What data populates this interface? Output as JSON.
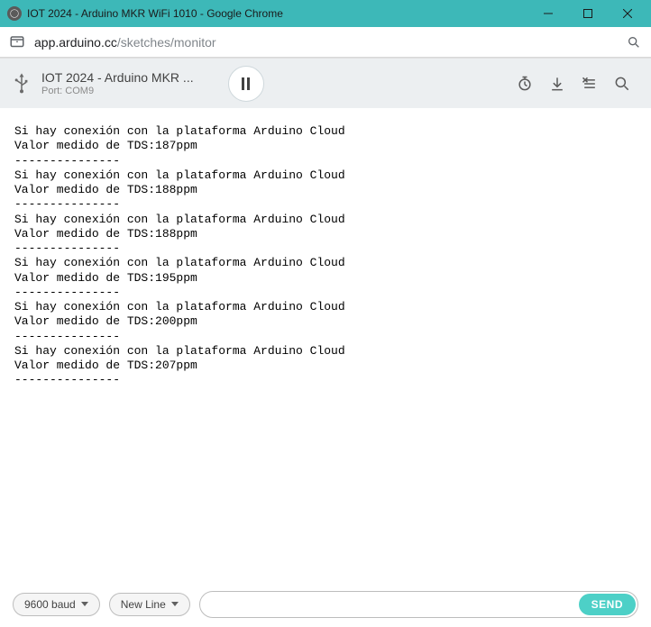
{
  "window": {
    "title": "IOT 2024 - Arduino MKR WiFi 1010 - Google Chrome"
  },
  "address": {
    "host": "app.arduino.cc",
    "path": "/sketches/monitor"
  },
  "toolbar": {
    "sketch_title": "IOT 2024 - Arduino MKR ...",
    "port_label": "Port: COM9"
  },
  "console": {
    "blocks": [
      {
        "line1": "Si hay conexión con la plataforma Arduino Cloud",
        "line2": "Valor medido de TDS:187ppm",
        "sep": "---------------"
      },
      {
        "line1": "Si hay conexión con la plataforma Arduino Cloud",
        "line2": "Valor medido de TDS:188ppm",
        "sep": "---------------"
      },
      {
        "line1": "Si hay conexión con la plataforma Arduino Cloud",
        "line2": "Valor medido de TDS:188ppm",
        "sep": "---------------"
      },
      {
        "line1": "Si hay conexión con la plataforma Arduino Cloud",
        "line2": "Valor medido de TDS:195ppm",
        "sep": "---------------"
      },
      {
        "line1": "Si hay conexión con la plataforma Arduino Cloud",
        "line2": "Valor medido de TDS:200ppm",
        "sep": "---------------"
      },
      {
        "line1": "Si hay conexión con la plataforma Arduino Cloud",
        "line2": "Valor medido de TDS:207ppm",
        "sep": "---------------"
      }
    ]
  },
  "bottom": {
    "baud": "9600 baud",
    "line_ending": "New Line",
    "send_label": "SEND",
    "input_value": ""
  }
}
